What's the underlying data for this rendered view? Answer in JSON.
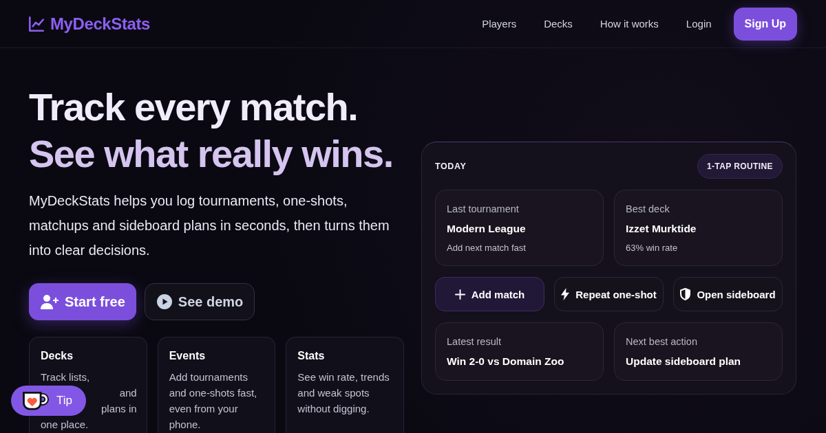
{
  "header": {
    "logo": "MyDeckStats",
    "nav": [
      {
        "label": "Players",
        "kind": "link"
      },
      {
        "label": "Decks",
        "kind": "link"
      },
      {
        "label": "How it works",
        "kind": "link"
      },
      {
        "label": "Login",
        "kind": "link"
      },
      {
        "label": "Sign Up",
        "kind": "button"
      }
    ]
  },
  "hero": {
    "headline": [
      "Track every match.",
      "See what really wins."
    ],
    "description": "MyDeckStats helps you log tournaments, one-shots, matchups and sideboard plans in seconds, then turns them into clear decisions.",
    "actions": [
      {
        "label": "Start free",
        "kind": "primary"
      },
      {
        "label": "See demo",
        "kind": "secondary"
      }
    ],
    "features": [
      {
        "title": "Decks",
        "fragments": [
          {
            "text": "Track lists,",
            "kind": "start"
          },
          {
            "text": "and",
            "kind": "end"
          },
          {
            "text": "plans in",
            "kind": "end"
          },
          {
            "text": "one place.",
            "kind": "start"
          }
        ]
      },
      {
        "title": "Events",
        "description": "Add tournaments and one-shots fast, even from your phone."
      },
      {
        "title": "Stats",
        "description": "See win rate, trends and weak spots without digging."
      }
    ]
  },
  "today_panel": {
    "heading": "TODAY",
    "badge": "1-TAP ROUTINE",
    "summary_cards": [
      {
        "label": "Last tournament",
        "value": "Modern League",
        "note": "Add next match fast"
      },
      {
        "label": "Best deck",
        "value": "Izzet Murktide",
        "note": "63% win rate"
      }
    ],
    "actions": [
      {
        "label": "Add match",
        "kind": "primary"
      },
      {
        "label": "Repeat one-shot",
        "kind": "secondary"
      },
      {
        "label": "Open sideboard",
        "kind": "secondary"
      }
    ],
    "result_cards": [
      {
        "label": "Latest result",
        "value": "Win 2-0 vs Domain Zoo"
      },
      {
        "label": "Next best action",
        "value": "Update sideboard plan"
      }
    ]
  },
  "tip_button": {
    "label": "Tip"
  }
}
